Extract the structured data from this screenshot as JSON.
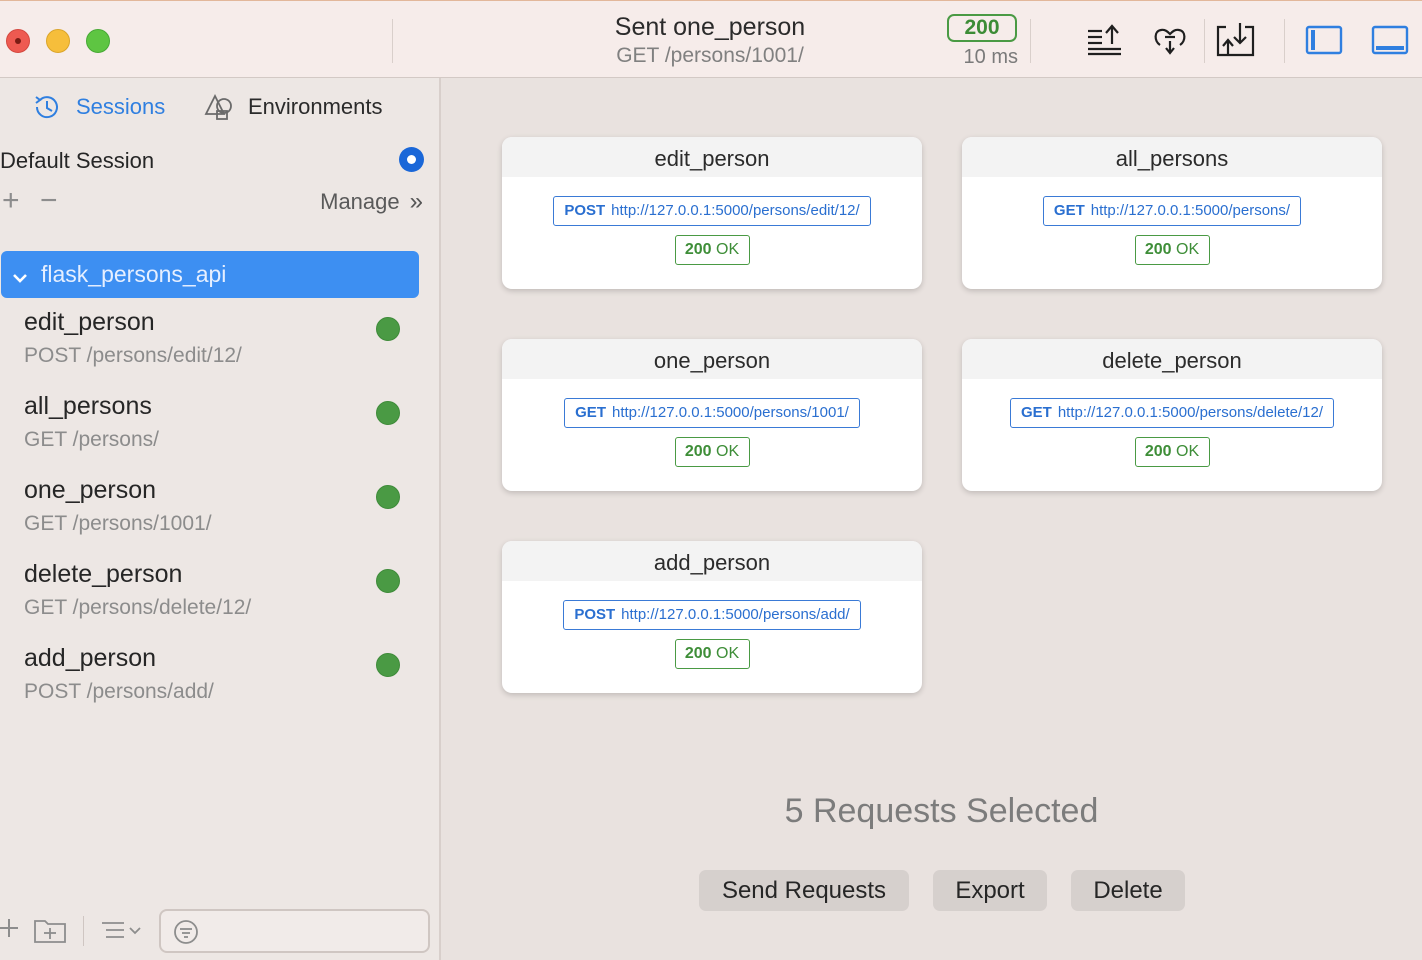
{
  "titlebar": {
    "title": "Sent one_person",
    "subtitle": "GET /persons/1001/",
    "status_code": "200",
    "duration": "10 ms",
    "icons": [
      "export-icon",
      "heart-link-icon",
      "import-tray-icon",
      "toggle-sidebar-icon",
      "toggle-bottom-panel-icon"
    ],
    "accent": "#2f7fe0",
    "status_color": "#4a9a44"
  },
  "sidebar": {
    "tabs": [
      {
        "label": "Sessions",
        "icon": "clock-icon",
        "active": true
      },
      {
        "label": "Environments",
        "icon": "shapes-icon",
        "active": false
      }
    ],
    "session_name": "Default Session",
    "manage_label": "Manage",
    "folder": {
      "label": "flask_persons_api",
      "expanded": true
    },
    "requests": [
      {
        "name": "edit_person",
        "route": "POST /persons/edit/12/"
      },
      {
        "name": "all_persons",
        "route": "GET /persons/"
      },
      {
        "name": "one_person",
        "route": "GET /persons/1001/"
      },
      {
        "name": "delete_person",
        "route": "GET /persons/delete/12/"
      },
      {
        "name": "add_person",
        "route": "POST /persons/add/"
      }
    ],
    "filter_placeholder": ""
  },
  "main": {
    "cards": [
      {
        "name": "edit_person",
        "method": "POST",
        "url": "http://127.0.0.1:5000/persons/edit/12/",
        "code": "200",
        "text": "OK"
      },
      {
        "name": "all_persons",
        "method": "GET",
        "url": "http://127.0.0.1:5000/persons/",
        "code": "200",
        "text": "OK"
      },
      {
        "name": "one_person",
        "method": "GET",
        "url": "http://127.0.0.1:5000/persons/1001/",
        "code": "200",
        "text": "OK"
      },
      {
        "name": "delete_person",
        "method": "GET",
        "url": "http://127.0.0.1:5000/persons/delete/12/",
        "code": "200",
        "text": "OK"
      },
      {
        "name": "add_person",
        "method": "POST",
        "url": "http://127.0.0.1:5000/persons/add/",
        "code": "200",
        "text": "OK"
      }
    ],
    "selection_label": "5 Requests Selected",
    "buttons": {
      "send": "Send Requests",
      "export": "Export",
      "delete": "Delete"
    }
  }
}
